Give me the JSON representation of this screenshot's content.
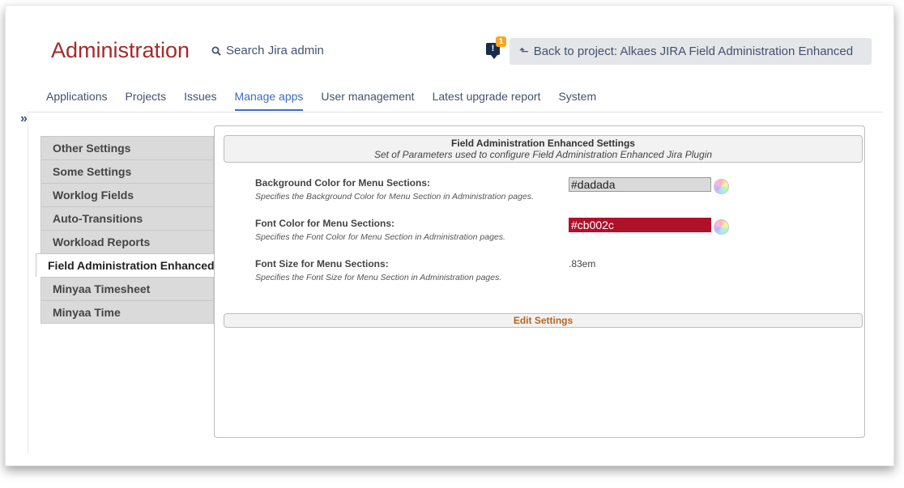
{
  "header": {
    "title": "Administration",
    "search_label": "Search Jira admin",
    "notification_count": "1",
    "notification_glyph": "!",
    "back_label": "Back to project: Alkaes JIRA Field Administration Enhanced"
  },
  "tabs": [
    {
      "label": "Applications",
      "active": false
    },
    {
      "label": "Projects",
      "active": false
    },
    {
      "label": "Issues",
      "active": false
    },
    {
      "label": "Manage apps",
      "active": true
    },
    {
      "label": "User management",
      "active": false
    },
    {
      "label": "Latest upgrade report",
      "active": false
    },
    {
      "label": "System",
      "active": false
    }
  ],
  "sidebar": {
    "expand_glyph": "»",
    "items": [
      {
        "label": "Other Settings"
      },
      {
        "label": "Some Settings"
      },
      {
        "label": "Worklog Fields"
      },
      {
        "label": "Auto-Transitions"
      },
      {
        "label": "Workload Reports"
      },
      {
        "label": "Field Administration Enhanced",
        "active": true
      },
      {
        "label": "Minyaa Timesheet"
      },
      {
        "label": "Minyaa Time"
      }
    ]
  },
  "panel": {
    "title": "Field Administration Enhanced Settings",
    "subtitle": "Set of Parameters used to configure Field Administration Enhanced Jira Plugin",
    "bg_color": {
      "label": "Background Color for Menu Sections:",
      "description": "Specifies the Background Color for Menu Section in Administration pages.",
      "value": "#dadada"
    },
    "font_color": {
      "label": "Font Color for Menu Sections:",
      "description": "Specifies the Font Color for Menu Section in Administration pages.",
      "value": "#cb002c"
    },
    "font_size": {
      "label": "Font Size for Menu Sections:",
      "description": "Specifies the Font Size for Menu Section in Administration pages.",
      "value": ".83em"
    },
    "edit_label": "Edit Settings"
  },
  "colors": {
    "title_red": "#a52a2a",
    "active_tab": "#3b6cc4",
    "edit_orange": "#b5651d",
    "font_color_field_text": "#ffffff"
  }
}
